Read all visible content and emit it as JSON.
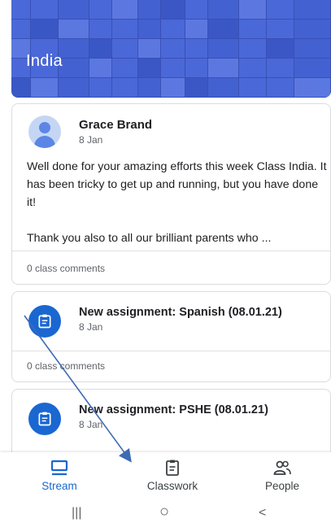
{
  "banner": {
    "class_name": "India"
  },
  "post": {
    "author": "Grace Brand",
    "date": "8 Jan",
    "paragraph1": "Well done for your amazing efforts this week Class India. It has been tricky to get up and running, but you have done it!",
    "paragraph2": "Thank you also to all our brilliant parents who ...",
    "comments": "0 class comments"
  },
  "assignments": [
    {
      "title": "New assignment: Spanish (08.01.21)",
      "date": "8 Jan",
      "comments": "0 class comments"
    },
    {
      "title": "New assignment: PSHE (08.01.21)",
      "date": "8 Jan"
    }
  ],
  "nav": {
    "stream": "Stream",
    "classwork": "Classwork",
    "people": "People"
  },
  "system_nav": {
    "recents": "|||",
    "home": "○",
    "back": "<"
  },
  "colors": {
    "accent": "#1967d2",
    "assignment_icon": "#1a67d2",
    "banner": "#4b68d8",
    "arrow": "#3d6bb3"
  },
  "icons": {
    "avatar": "person-avatar-icon",
    "assignment": "assignment-clipboard-icon",
    "stream": "stream-icon",
    "classwork": "classwork-clipboard-icon",
    "people": "people-icon"
  }
}
